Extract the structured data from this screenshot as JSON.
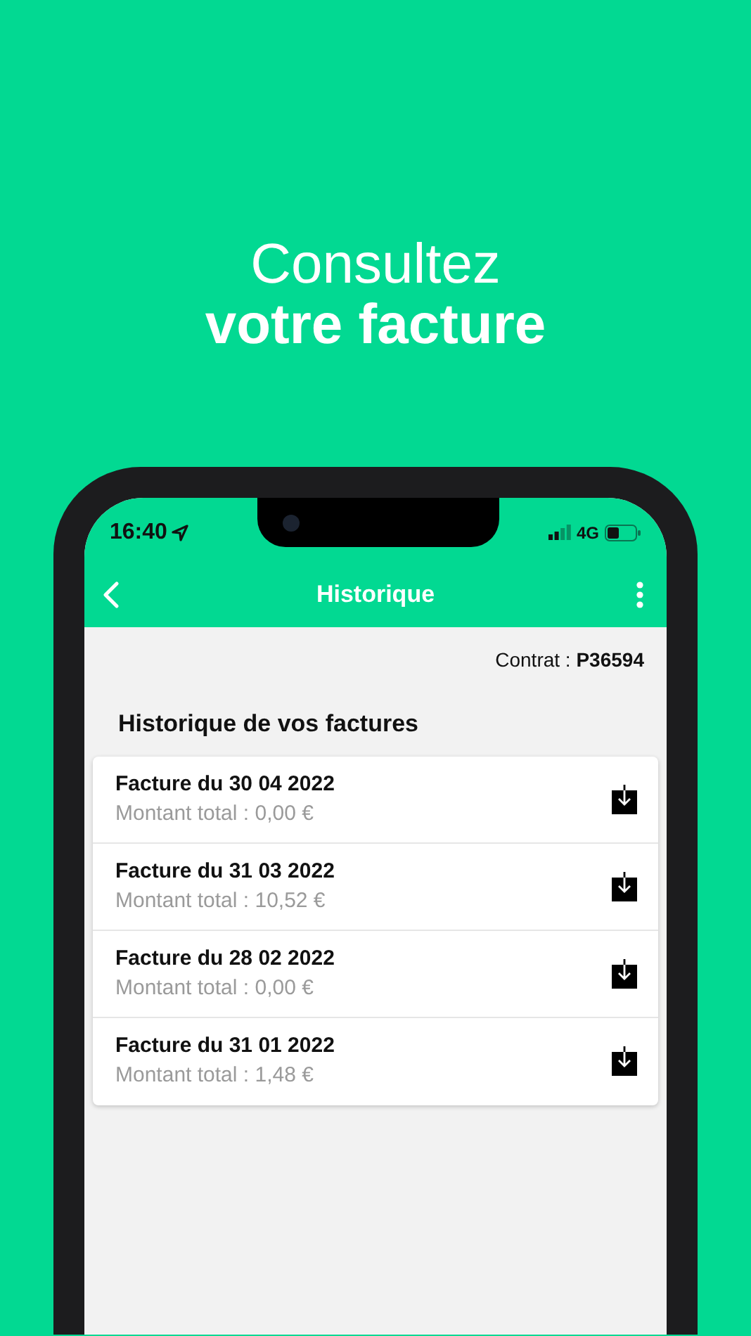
{
  "headline": {
    "line_1": "Consultez",
    "line_2": "votre facture"
  },
  "status_bar": {
    "time": "16:40",
    "network": "4G"
  },
  "nav_bar": {
    "title": "Historique"
  },
  "contract": "Contrat : **P36594**",
  "section_title": "Historique de vos factures",
  "invoices": [
    {
      "title": "Facture du 30 04 2022",
      "amount": "Montant total : 0,00 €"
    },
    {
      "title": "Facture du 31 03 2022",
      "amount": "Montant total : 10,52 €"
    },
    {
      "title": "Facture du 28 02 2022",
      "amount": "Montant total : 0,00 €"
    },
    {
      "title": "Facture du 31 01 2022",
      "amount": "Montant total : 1,48 €"
    }
  ]
}
